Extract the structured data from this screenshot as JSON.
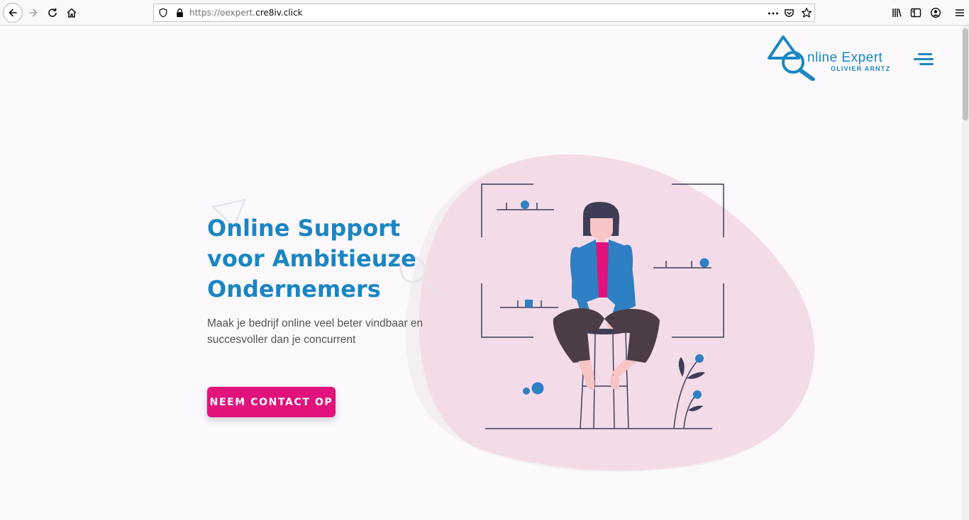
{
  "browser": {
    "url_scheme": "https://",
    "url_sub": "oexpert.",
    "url_host": "cre8iv.click"
  },
  "header": {
    "logo_brand": "nline  Expert",
    "logo_owner": "OLIVIER ARNTZ"
  },
  "hero": {
    "title_lines": [
      "Online Support",
      "voor Ambitieuze",
      "Ondernemers"
    ],
    "subtitle_lines": [
      "Maak je bedrijf online veel beter vindbaar en",
      "succesvoller dan je concurrent"
    ],
    "cta_label": "NEEM CONTACT OP"
  },
  "colors": {
    "brand_blue": "#1a86c4",
    "accent_pink": "#e2127c",
    "blob_pink": "#f3dce8"
  },
  "icons": [
    "back-arrow-icon",
    "forward-arrow-icon",
    "reload-icon",
    "home-icon",
    "shield-icon",
    "lock-icon",
    "more-icon",
    "pocket-icon",
    "star-icon",
    "library-icon",
    "sidebar-icon",
    "account-icon",
    "menu-icon",
    "hamburger-icon"
  ]
}
